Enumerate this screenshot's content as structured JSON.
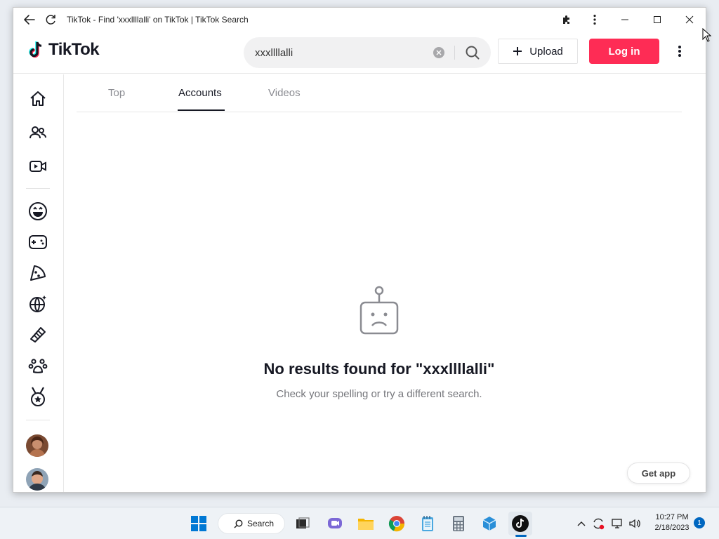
{
  "window": {
    "title": "TikTok - Find 'xxxllllalli' on TikTok | TikTok Search"
  },
  "header": {
    "logo_text": "TikTok",
    "search": {
      "value": "xxxllllalli",
      "placeholder": "Search"
    },
    "upload_label": "Upload",
    "login_label": "Log in"
  },
  "tabs": [
    {
      "label": "Top",
      "active": false
    },
    {
      "label": "Accounts",
      "active": true
    },
    {
      "label": "Videos",
      "active": false
    }
  ],
  "empty_state": {
    "title": "No results found for \"xxxllllalli\"",
    "subtitle": "Check your spelling or try a different search."
  },
  "get_app_label": "Get app",
  "sidebar": {
    "icons": [
      "home-icon",
      "following-icon",
      "live-icon",
      "comedy-icon",
      "gaming-icon",
      "food-icon",
      "dance-icon",
      "beauty-icon",
      "animals-icon",
      "sports-icon"
    ],
    "avatars": [
      "avatar-1",
      "avatar-2"
    ]
  },
  "taskbar": {
    "search_label": "Search",
    "time": "10:27 PM",
    "date": "2/18/2023",
    "notification_count": "1"
  },
  "colors": {
    "accent": "#fe2c55",
    "text": "#161823",
    "windows_accent": "#0067c0"
  }
}
